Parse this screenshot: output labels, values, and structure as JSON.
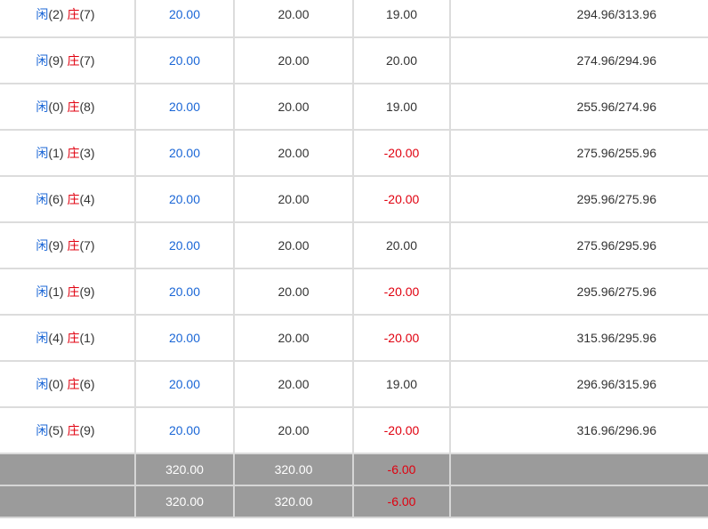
{
  "rows": [
    {
      "player_label": "闲",
      "player": "(2)",
      "banker_label": "庄",
      "banker": "(7)",
      "bet": "20.00",
      "valid": "20.00",
      "win": "19.00",
      "win_neg": false,
      "balance": "294.96/313.96"
    },
    {
      "player_label": "闲",
      "player": "(9)",
      "banker_label": "庄",
      "banker": "(7)",
      "bet": "20.00",
      "valid": "20.00",
      "win": "20.00",
      "win_neg": false,
      "balance": "274.96/294.96"
    },
    {
      "player_label": "闲",
      "player": "(0)",
      "banker_label": "庄",
      "banker": "(8)",
      "bet": "20.00",
      "valid": "20.00",
      "win": "19.00",
      "win_neg": false,
      "balance": "255.96/274.96"
    },
    {
      "player_label": "闲",
      "player": "(1)",
      "banker_label": "庄",
      "banker": "(3)",
      "bet": "20.00",
      "valid": "20.00",
      "win": "-20.00",
      "win_neg": true,
      "balance": "275.96/255.96"
    },
    {
      "player_label": "闲",
      "player": "(6)",
      "banker_label": "庄",
      "banker": "(4)",
      "bet": "20.00",
      "valid": "20.00",
      "win": "-20.00",
      "win_neg": true,
      "balance": "295.96/275.96"
    },
    {
      "player_label": "闲",
      "player": "(9)",
      "banker_label": "庄",
      "banker": "(7)",
      "bet": "20.00",
      "valid": "20.00",
      "win": "20.00",
      "win_neg": false,
      "balance": "275.96/295.96"
    },
    {
      "player_label": "闲",
      "player": "(1)",
      "banker_label": "庄",
      "banker": "(9)",
      "bet": "20.00",
      "valid": "20.00",
      "win": "-20.00",
      "win_neg": true,
      "balance": "295.96/275.96"
    },
    {
      "player_label": "闲",
      "player": "(4)",
      "banker_label": "庄",
      "banker": "(1)",
      "bet": "20.00",
      "valid": "20.00",
      "win": "-20.00",
      "win_neg": true,
      "balance": "315.96/295.96"
    },
    {
      "player_label": "闲",
      "player": "(0)",
      "banker_label": "庄",
      "banker": "(6)",
      "bet": "20.00",
      "valid": "20.00",
      "win": "19.00",
      "win_neg": false,
      "balance": "296.96/315.96"
    },
    {
      "player_label": "闲",
      "player": "(5)",
      "banker_label": "庄",
      "banker": "(9)",
      "bet": "20.00",
      "valid": "20.00",
      "win": "-20.00",
      "win_neg": true,
      "balance": "316.96/296.96"
    }
  ],
  "totals": [
    {
      "bet": "320.00",
      "valid": "320.00",
      "win": "-6.00"
    },
    {
      "bet": "320.00",
      "valid": "320.00",
      "win": "-6.00"
    }
  ],
  "colors": {
    "player": "#1a66d6",
    "banker": "#e0000f",
    "negative": "#e0000f",
    "total_bg": "#9b9b9b"
  }
}
